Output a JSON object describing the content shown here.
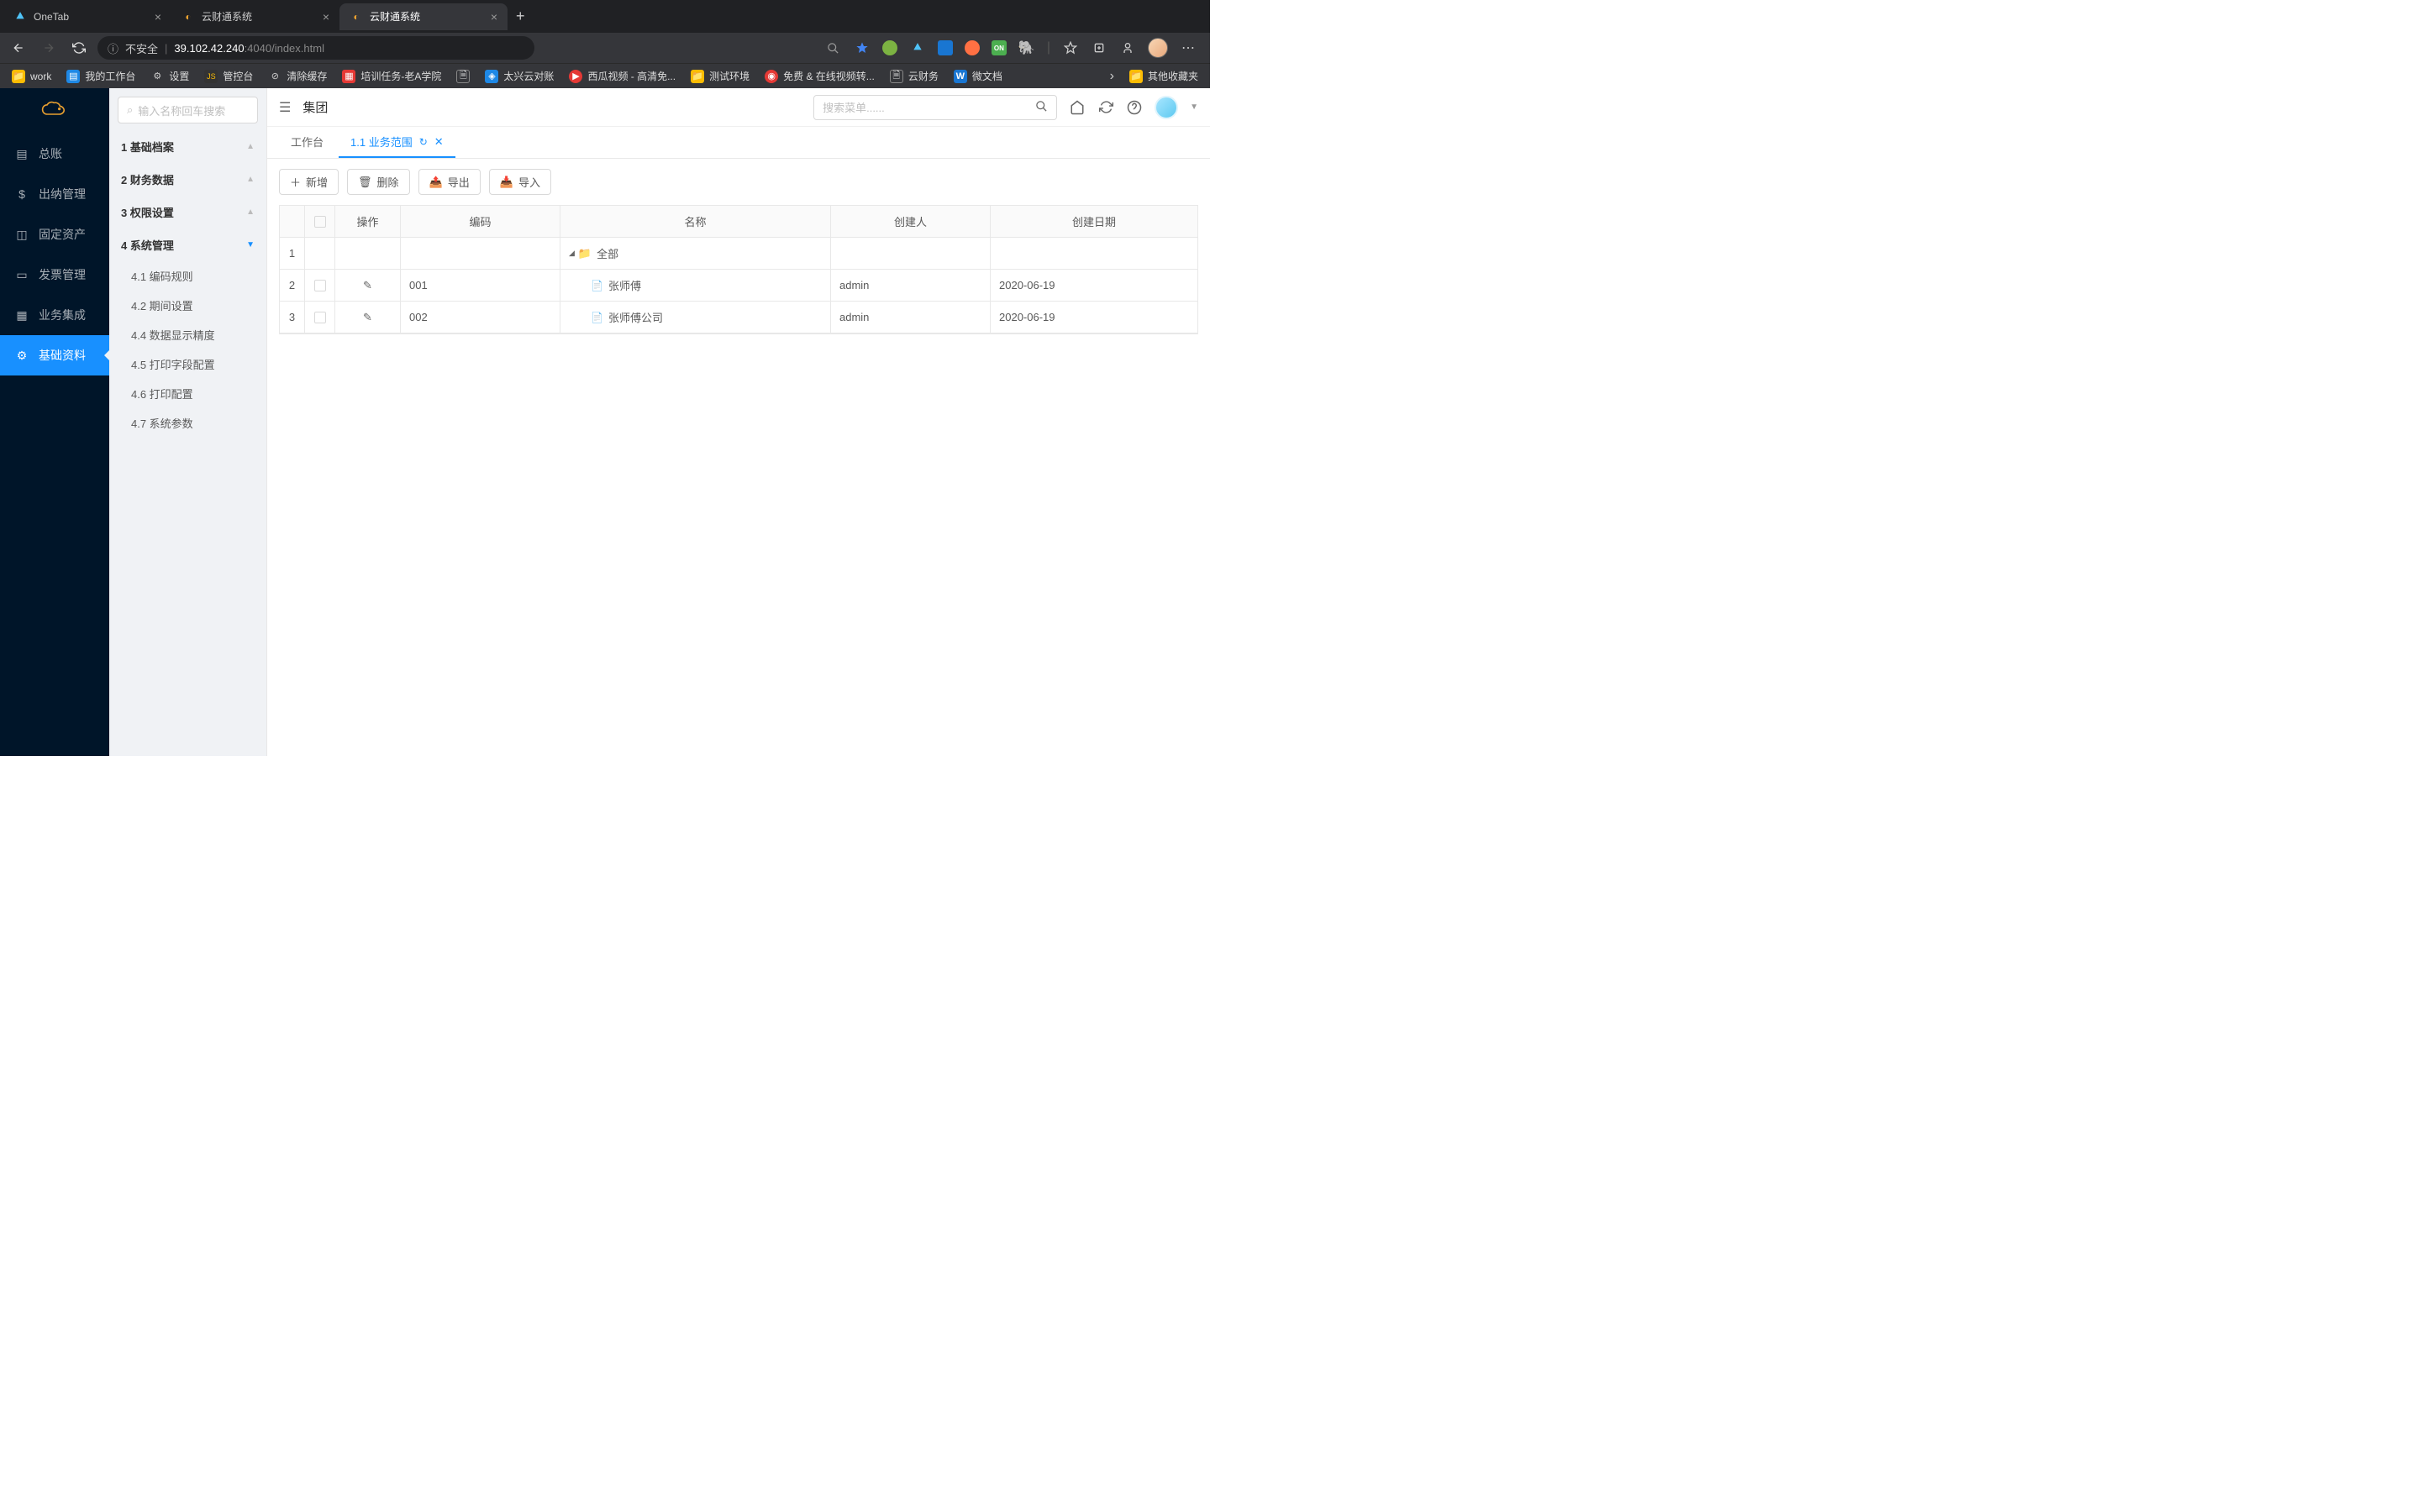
{
  "browser": {
    "tabs": [
      {
        "icon": "onetab",
        "title": "OneTab"
      },
      {
        "icon": "cloud",
        "title": "云财通系统"
      },
      {
        "icon": "cloud",
        "title": "云财通系统",
        "active": true
      }
    ],
    "security_label": "不安全",
    "url_host": "39.102.42.240",
    "url_path": ":4040/index.html",
    "bookmarks": [
      {
        "icon": "folder",
        "label": "work"
      },
      {
        "icon": "blue",
        "label": "我的工作台"
      },
      {
        "icon": "gear",
        "label": "设置"
      },
      {
        "icon": "js",
        "label": "管控台"
      },
      {
        "icon": "clear",
        "label": "清除缓存"
      },
      {
        "icon": "red",
        "label": "培训任务-老A学院"
      },
      {
        "icon": "page",
        "label": ""
      },
      {
        "icon": "blue2",
        "label": "太兴云对账"
      },
      {
        "icon": "play",
        "label": "西瓜视频 - 高清免..."
      },
      {
        "icon": "folder",
        "label": "测试环境"
      },
      {
        "icon": "red2",
        "label": "免费 & 在线视频转..."
      },
      {
        "icon": "page",
        "label": "云财务"
      },
      {
        "icon": "w",
        "label": "微文档"
      }
    ],
    "other_bookmarks": "其他收藏夹"
  },
  "sidebar": {
    "items": [
      {
        "icon": "ledger",
        "label": "总账"
      },
      {
        "icon": "cashier",
        "label": "出纳管理"
      },
      {
        "icon": "asset",
        "label": "固定资产"
      },
      {
        "icon": "invoice",
        "label": "发票管理"
      },
      {
        "icon": "integration",
        "label": "业务集成"
      },
      {
        "icon": "settings",
        "label": "基础资料",
        "active": true
      }
    ]
  },
  "submenu": {
    "search_placeholder": "输入名称回车搜索",
    "sections": [
      {
        "label": "1 基础档案",
        "expanded": false
      },
      {
        "label": "2 财务数据",
        "expanded": false
      },
      {
        "label": "3 权限设置",
        "expanded": false
      },
      {
        "label": "4 系统管理",
        "expanded": true,
        "items": [
          {
            "label": "4.1 编码规则"
          },
          {
            "label": "4.2 期间设置"
          },
          {
            "label": "4.4 数据显示精度"
          },
          {
            "label": "4.5 打印字段配置"
          },
          {
            "label": "4.6 打印配置"
          },
          {
            "label": "4.7 系统参数"
          }
        ]
      }
    ]
  },
  "header": {
    "breadcrumb": "集团",
    "search_placeholder": "搜索菜单......"
  },
  "tabs": [
    {
      "label": "工作台"
    },
    {
      "label": "1.1 业务范围",
      "active": true,
      "closable": true
    }
  ],
  "toolbar": {
    "add": "新增",
    "delete": "删除",
    "export": "导出",
    "import": "导入"
  },
  "table": {
    "columns": {
      "op": "操作",
      "code": "编码",
      "name": "名称",
      "creator": "创建人",
      "date": "创建日期"
    },
    "rows": [
      {
        "num": "1",
        "code": "",
        "name": "全部",
        "type": "folder",
        "creator": "",
        "date": "",
        "parent": true
      },
      {
        "num": "2",
        "code": "001",
        "name": "张师傅",
        "type": "file",
        "creator": "admin",
        "date": "2020-06-19"
      },
      {
        "num": "3",
        "code": "002",
        "name": "张师傅公司",
        "type": "file",
        "creator": "admin",
        "date": "2020-06-19"
      }
    ]
  }
}
